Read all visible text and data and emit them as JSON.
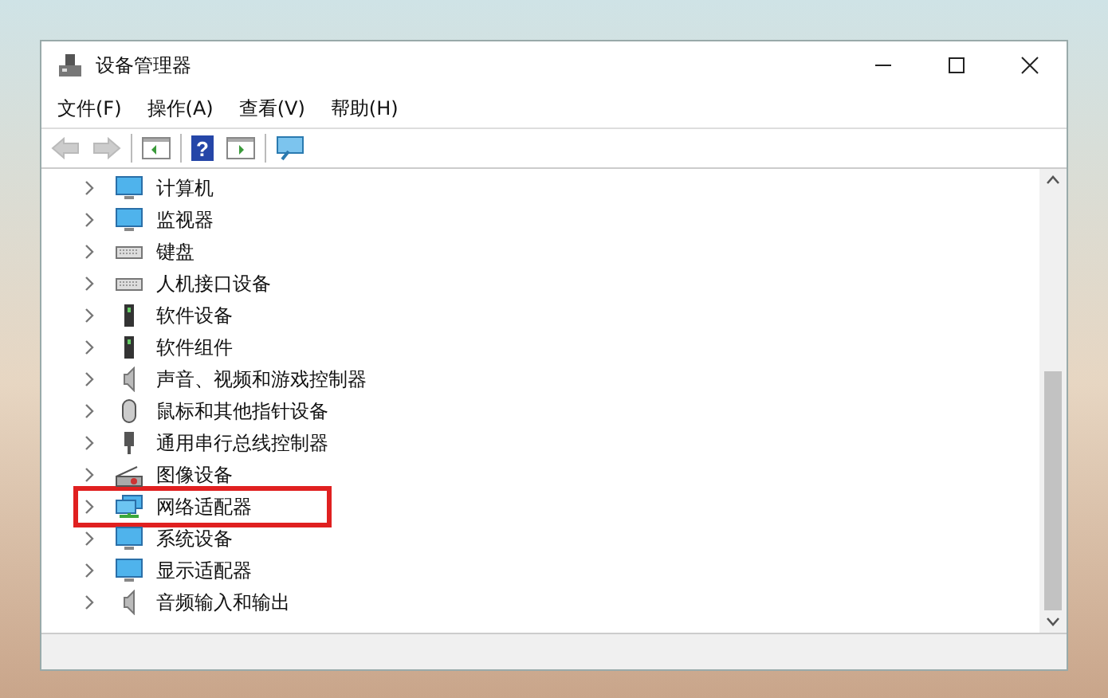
{
  "window": {
    "title": "设备管理器"
  },
  "menu": [
    "文件(F)",
    "操作(A)",
    "查看(V)",
    "帮助(H)"
  ],
  "toolbar": [
    {
      "kind": "back",
      "disabled": true
    },
    {
      "kind": "forward",
      "disabled": true
    },
    {
      "kind": "separator"
    },
    {
      "kind": "tree-pane",
      "disabled": false
    },
    {
      "kind": "separator"
    },
    {
      "kind": "help",
      "disabled": false,
      "glyph": "?"
    },
    {
      "kind": "properties",
      "disabled": false
    },
    {
      "kind": "separator"
    },
    {
      "kind": "scan",
      "disabled": false
    }
  ],
  "tree": [
    {
      "label": "计算机",
      "kind": "monitor",
      "expanded": false,
      "highlighted": false
    },
    {
      "label": "监视器",
      "kind": "monitor",
      "expanded": false,
      "highlighted": false
    },
    {
      "label": "键盘",
      "kind": "keyboard",
      "expanded": false,
      "highlighted": false
    },
    {
      "label": "人机接口设备",
      "kind": "keyboard",
      "expanded": false,
      "highlighted": false
    },
    {
      "label": "软件设备",
      "kind": "device",
      "expanded": false,
      "highlighted": false
    },
    {
      "label": "软件组件",
      "kind": "device",
      "expanded": false,
      "highlighted": false
    },
    {
      "label": "声音、视频和游戏控制器",
      "kind": "speaker",
      "expanded": false,
      "highlighted": false
    },
    {
      "label": "鼠标和其他指针设备",
      "kind": "mouse",
      "expanded": false,
      "highlighted": false
    },
    {
      "label": "通用串行总线控制器",
      "kind": "plug",
      "expanded": false,
      "highlighted": false
    },
    {
      "label": "图像设备",
      "kind": "camera",
      "expanded": false,
      "highlighted": false
    },
    {
      "label": "网络适配器",
      "kind": "network",
      "expanded": false,
      "highlighted": true
    },
    {
      "label": "系统设备",
      "kind": "monitor",
      "expanded": false,
      "highlighted": false
    },
    {
      "label": "显示适配器",
      "kind": "monitor",
      "expanded": false,
      "highlighted": false
    },
    {
      "label": "音频输入和输出",
      "kind": "speaker",
      "expanded": false,
      "highlighted": false
    }
  ]
}
